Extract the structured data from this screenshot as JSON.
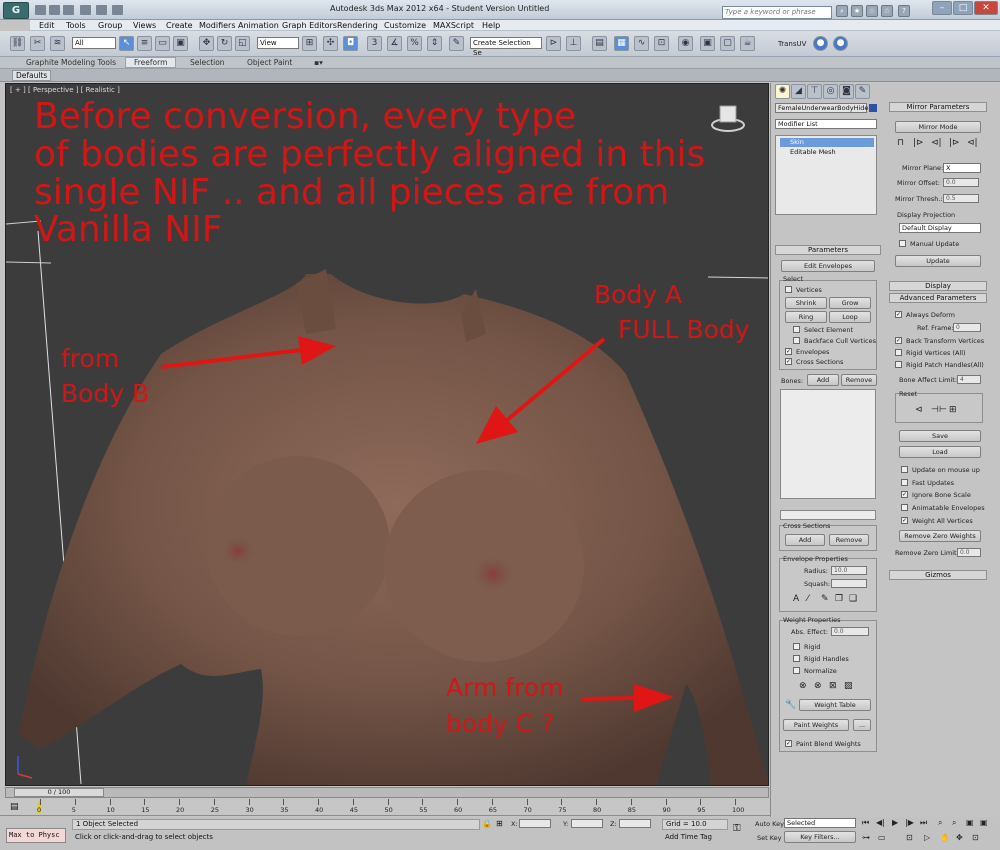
{
  "window": {
    "title": "Autodesk 3ds Max 2012 x64 - Student Version    Untitled",
    "app_logo": "G",
    "search_placeholder": "Type a keyword or phrase"
  },
  "menu": [
    "Edit",
    "Tools",
    "Group",
    "Views",
    "Create",
    "Modifiers",
    "Animation",
    "Graph Editors",
    "Rendering",
    "Customize",
    "MAXScript",
    "Help"
  ],
  "toolbar": {
    "selection_filter": "All",
    "ref_coord": "View",
    "named_selection": "Create Selection Se",
    "transuv_label": "TransUV"
  },
  "ribbon": {
    "tabs": [
      "Graphite Modeling Tools",
      "Freeform",
      "Selection",
      "Object Paint"
    ],
    "active_tab": "Freeform",
    "sub_label": "Defaults"
  },
  "viewport": {
    "label": "[ + ] [ Perspective ] [ Realistic ]",
    "notes": {
      "main": [
        "Before conversion, every type",
        "of bodies are perfectly aligned in this",
        "single NIF .. and all pieces are from Vanilla NIF"
      ],
      "body_a_1": "Body A",
      "body_a_2": "FULL Body",
      "from_1": "from",
      "from_2": "Body B",
      "arm_1": "Arm from",
      "arm_2": "body C ?"
    }
  },
  "cmdpanel": {
    "object_name": "FemaleUnderwearBodyHideM",
    "modifier_list": "Modifier List",
    "stack": [
      "Skin",
      "Editable Mesh"
    ],
    "parameters": {
      "header": "Parameters",
      "edit_envelopes": "Edit Envelopes",
      "select_label": "Select",
      "vertices": "Vertices",
      "shrink": "Shrink",
      "grow": "Grow",
      "ring": "Ring",
      "loop": "Loop",
      "select_element": "Select Element",
      "backface": "Backface Cull Vertices",
      "envelopes": "Envelopes",
      "cross_sections": "Cross Sections",
      "bones": "Bones:",
      "add": "Add",
      "remove": "Remove"
    },
    "cross_sections": {
      "header": "Cross Sections",
      "add": "Add",
      "remove": "Remove"
    },
    "envelope_props": {
      "header": "Envelope Properties",
      "radius_label": "Radius:",
      "radius": "10.0",
      "squash_label": "Squash:",
      "squash": ""
    },
    "weight_props": {
      "header": "Weight Properties",
      "abs_effect_label": "Abs. Effect:",
      "abs_effect": "0.0",
      "rigid": "Rigid",
      "rigid_handles": "Rigid Handles",
      "normalize": "Normalize",
      "weight_table": "Weight Table",
      "paint_weights": "Paint Weights",
      "paint_blend": "Paint Blend Weights",
      "ellipsis": "..."
    },
    "mirror": {
      "header": "Mirror Parameters",
      "mirror_mode": "Mirror Mode",
      "plane_label": "Mirror Plane:",
      "plane": "X",
      "offset_label": "Mirror Offset:",
      "offset": "0.0",
      "thresh_label": "Mirror Thresh.:",
      "thresh": "0.5",
      "projection_label": "Display Projection",
      "projection": "Default Display",
      "manual_update": "Manual Update",
      "update": "Update"
    },
    "display_header": "Display",
    "advanced": {
      "header": "Advanced Parameters",
      "always_deform": "Always Deform",
      "ref_frame_label": "Ref. Frame:",
      "ref_frame": "0",
      "back_transform": "Back Transform Vertices",
      "rigid_vertices": "Rigid Vertices (All)",
      "rigid_patch": "Rigid Patch Handles(All)",
      "bone_limit_label": "Bone Affect Limit:",
      "bone_limit": "4",
      "reset": "Reset",
      "save": "Save",
      "load": "Load",
      "update_mouse": "Update on mouse up",
      "fast_updates": "Fast Updates",
      "ignore_bone_scale": "Ignore Bone Scale",
      "animatable_env": "Animatable Envelopes",
      "weight_all": "Weight All Vertices",
      "remove_zero": "Remove Zero Weights",
      "remove_zero_limit_label": "Remove Zero Limit:",
      "remove_zero_limit": "0.0"
    },
    "gizmos_header": "Gizmos"
  },
  "timeline": {
    "frame_counter": "0 / 100",
    "ticks": [
      "0",
      "5",
      "10",
      "15",
      "20",
      "25",
      "30",
      "35",
      "40",
      "45",
      "50",
      "55",
      "60",
      "65",
      "70",
      "75",
      "80",
      "85",
      "90",
      "95",
      "100"
    ]
  },
  "status": {
    "script_listener": "Max to Physc",
    "selection": "1 Object Selected",
    "prompt": "Click or click-and-drag to select objects",
    "x_label": "X:",
    "y_label": "Y:",
    "z_label": "Z:",
    "grid": "Grid = 10.0",
    "add_time_tag": "Add Time Tag",
    "auto_key": "Auto Key",
    "set_key": "Set Key",
    "key_mode": "Selected",
    "key_filters": "Key Filters..."
  },
  "colors": {
    "annotation": "#d01717",
    "viewport_bg": "#3c3c3c",
    "skin": "#7a5a4c"
  }
}
